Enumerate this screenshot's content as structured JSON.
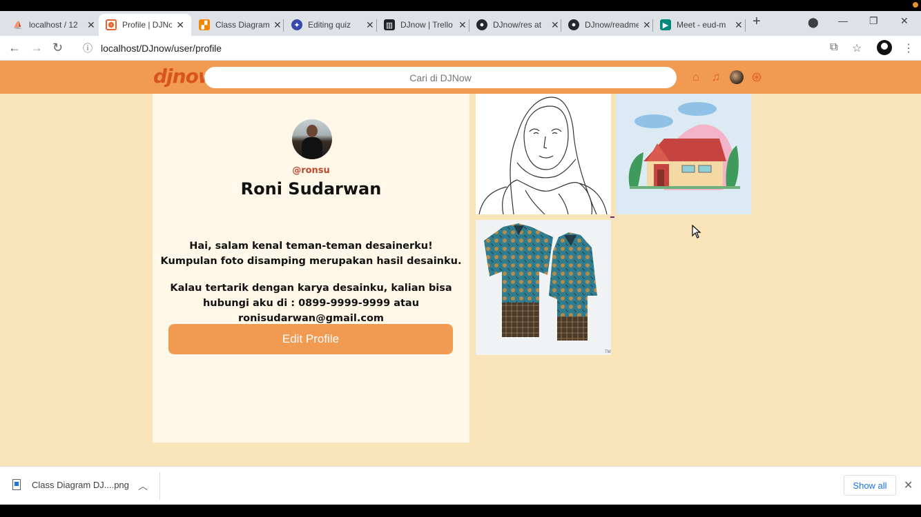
{
  "browser": {
    "tabs": [
      {
        "title": "localhost / 12",
        "favicon": "phpmyadmin-icon",
        "color": "#f29111"
      },
      {
        "title": "Profile | DJNow",
        "favicon": "djnow-icon",
        "color": "#e8632b",
        "active": true
      },
      {
        "title": "Class Diagram",
        "favicon": "draw-icon",
        "color": "#f08705"
      },
      {
        "title": "Editing quiz",
        "favicon": "quiz-icon",
        "color": "#3949ab"
      },
      {
        "title": "DJnow | Trello",
        "favicon": "trello-icon",
        "color": "#1d2125"
      },
      {
        "title": "DJnow/res at",
        "favicon": "github-icon",
        "color": "#24292f"
      },
      {
        "title": "DJnow/readme",
        "favicon": "github-icon",
        "color": "#24292f"
      },
      {
        "title": "Meet - eud-m",
        "favicon": "meet-icon",
        "color": "#00897b"
      }
    ],
    "new_tab": "+",
    "url": "localhost/DJnow/user/profile"
  },
  "site": {
    "logo": "djnow",
    "search_placeholder": "Cari di DJNow"
  },
  "profile": {
    "username": "@ronsu",
    "name": "Roni Sudarwan",
    "bio_1": "Hai, salam kenal teman-teman desainerku! Kumpulan foto disamping merupakan hasil desainku.",
    "bio_2": "Kalau tertarik dengan karya desainku, kalian bisa hubungi aku di : 0899-9999-9999 atau ronisudarwan@gmail.com",
    "edit_button": "Edit Profile"
  },
  "gallery": [
    {
      "name": "hijab-line-drawing"
    },
    {
      "name": "house-illustration"
    },
    {
      "name": "batik-shirts-photo"
    }
  ],
  "downloads": {
    "file": "Class Diagram DJ....png",
    "show_all": "Show all"
  },
  "colors": {
    "navbar": "#f09a52",
    "page_bg": "#f9e3b8",
    "card_bg": "#fff8e8",
    "accent": "#d8531e"
  }
}
